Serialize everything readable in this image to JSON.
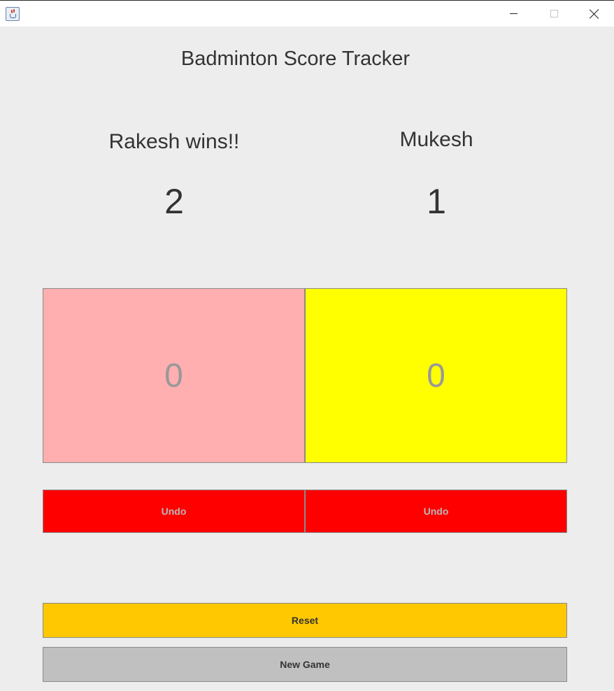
{
  "window": {
    "icon": "java-cup-icon",
    "controls": [
      "minimize-icon",
      "maximize-icon",
      "close-icon"
    ]
  },
  "app": {
    "title": "Badminton Score Tracker"
  },
  "players": [
    {
      "name": "Rakesh wins!!",
      "sets": "2",
      "score": "0",
      "panel_color": "#ffafaf",
      "undo_label": "Undo"
    },
    {
      "name": "Mukesh",
      "sets": "1",
      "score": "0",
      "panel_color": "#ffff00",
      "undo_label": "Undo"
    }
  ],
  "actions": {
    "reset_label": "Reset",
    "reset_color": "#ffc800",
    "new_game_label": "New Game",
    "new_game_color": "#c0c0c0",
    "undo_color": "#ff0000"
  }
}
